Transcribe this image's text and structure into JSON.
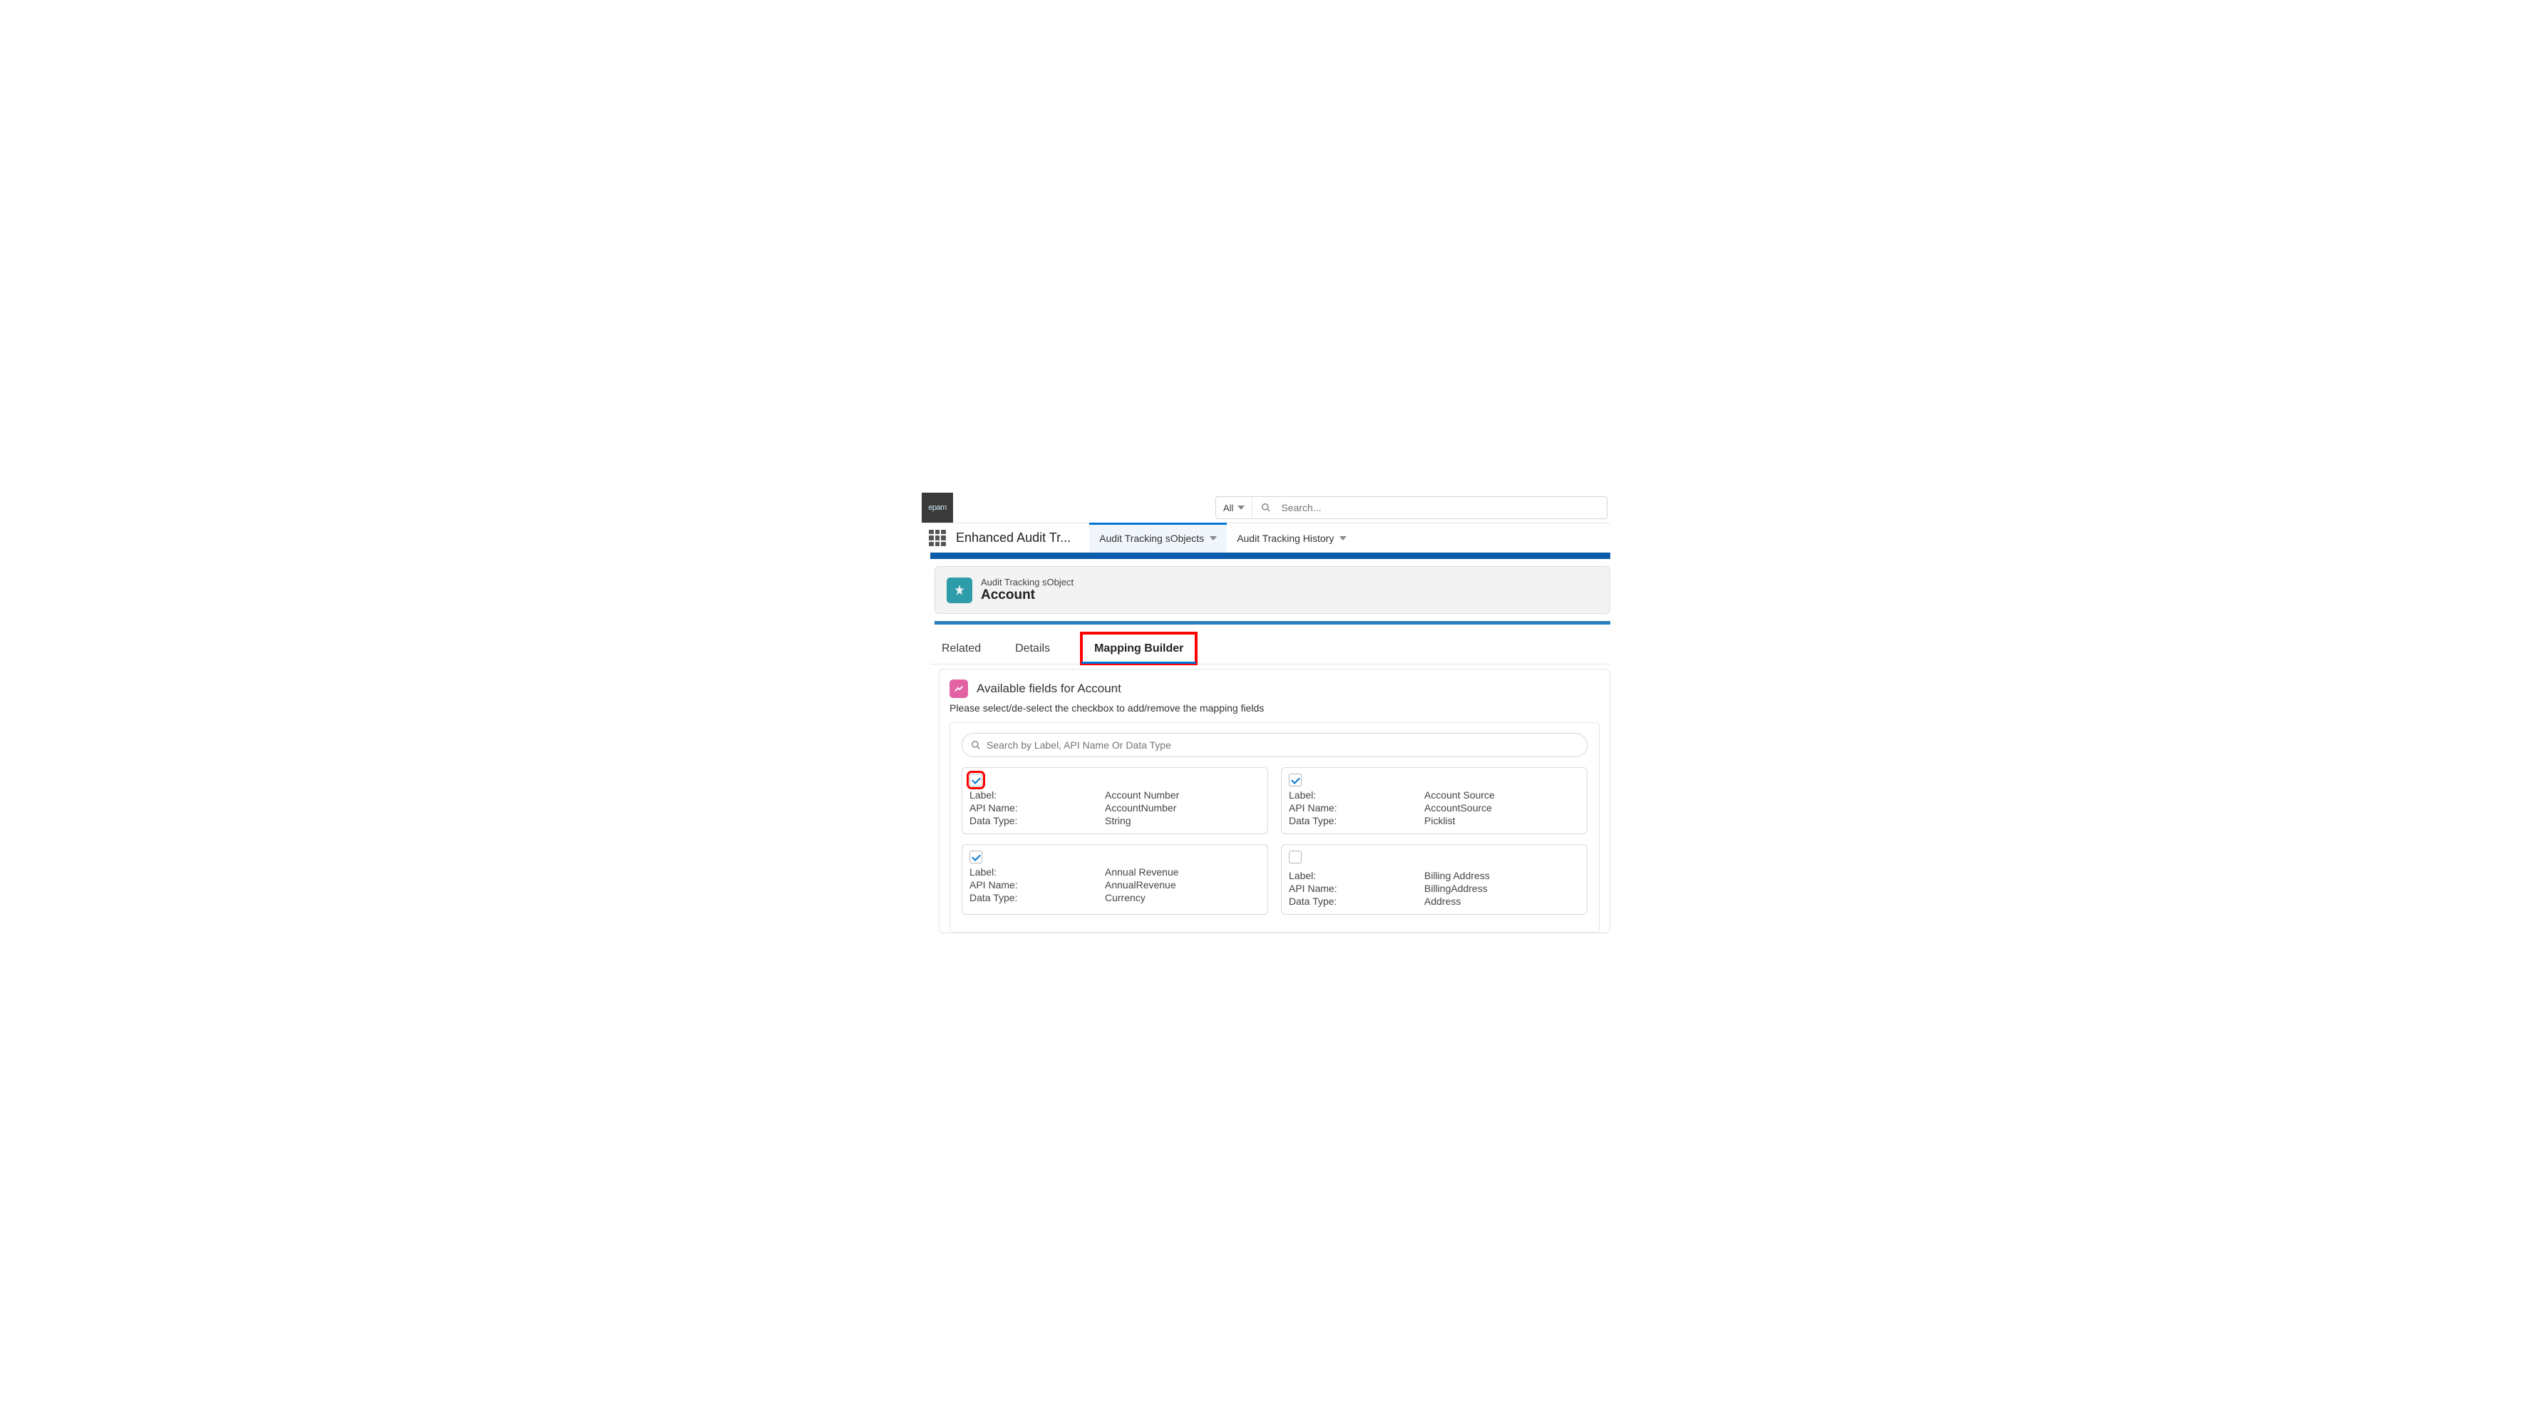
{
  "logo_text": "epam",
  "search": {
    "scope": "All",
    "placeholder": "Search..."
  },
  "app_name": "Enhanced Audit Tr...",
  "nav_tabs": [
    {
      "label": "Audit Tracking sObjects",
      "active": true
    },
    {
      "label": "Audit Tracking History",
      "active": false
    }
  ],
  "record": {
    "type_label": "Audit Tracking sObject",
    "title": "Account"
  },
  "record_tabs": [
    {
      "label": "Related",
      "highlight": false
    },
    {
      "label": "Details",
      "highlight": false
    },
    {
      "label": "Mapping Builder",
      "highlight": true
    }
  ],
  "section_title": "Available fields for Account",
  "help_text": "Please select/de-select the checkbox to add/remove the mapping fields",
  "inner_search_placeholder": "Search by Label, API Name Or Data Type",
  "kv_labels": {
    "label": "Label:",
    "api": "API Name:",
    "type": "Data Type:"
  },
  "fields": [
    {
      "checked": true,
      "red_highlight": true,
      "label": "Account Number",
      "api": "AccountNumber",
      "type": "String"
    },
    {
      "checked": true,
      "red_highlight": false,
      "label": "Account Source",
      "api": "AccountSource",
      "type": "Picklist"
    },
    {
      "checked": true,
      "red_highlight": false,
      "label": "Annual Revenue",
      "api": "AnnualRevenue",
      "type": "Currency"
    },
    {
      "checked": false,
      "red_highlight": false,
      "label": "Billing Address",
      "api": "BillingAddress",
      "type": "Address"
    }
  ]
}
